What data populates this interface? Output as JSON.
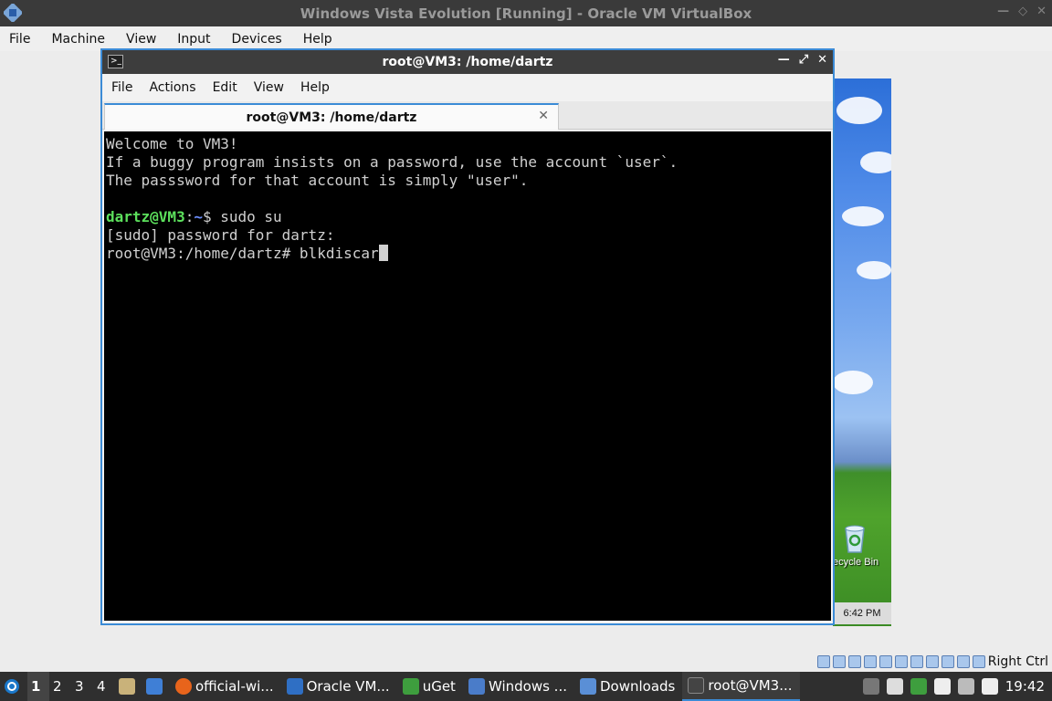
{
  "vbox": {
    "title": "Windows Vista Evolution [Running] - Oracle VM VirtualBox",
    "menu": [
      "File",
      "Machine",
      "View",
      "Input",
      "Devices",
      "Help"
    ],
    "status_hostkey": "Right Ctrl"
  },
  "terminal": {
    "title": "root@VM3: /home/dartz",
    "menu": [
      "File",
      "Actions",
      "Edit",
      "View",
      "Help"
    ],
    "tab_label": "root@VM3: /home/dartz",
    "lines": {
      "l1": "Welcome to VM3!",
      "l2": "If a buggy program insists on a password, use the account `user`.",
      "l3": "The passsword for that account is simply \"user\".",
      "prompt_user": "dartz@VM3",
      "prompt_colon": ":",
      "prompt_path": "~",
      "prompt_cmd": "$ sudo su",
      "l5": "[sudo] password for dartz:",
      "l6": "root@VM3:/home/dartz# blkdiscar"
    }
  },
  "guest_desktop": {
    "recycle_label": "ecycle Bin",
    "clock": "6:42 PM"
  },
  "taskbar": {
    "workspaces": [
      "1",
      "2",
      "3",
      "4"
    ],
    "windows": [
      {
        "label": "official-wi...",
        "color": "#e8641b"
      },
      {
        "label": "Oracle VM...",
        "color": "#2f6fc4"
      },
      {
        "label": "uGet",
        "color": "#3e9e3e"
      },
      {
        "label": "Windows ...",
        "color": "#4a7cc9"
      },
      {
        "label": "Downloads",
        "color": "#5a8fd6"
      },
      {
        "label": "root@VM3...",
        "color": "#444444"
      }
    ],
    "clock": "19:42"
  }
}
